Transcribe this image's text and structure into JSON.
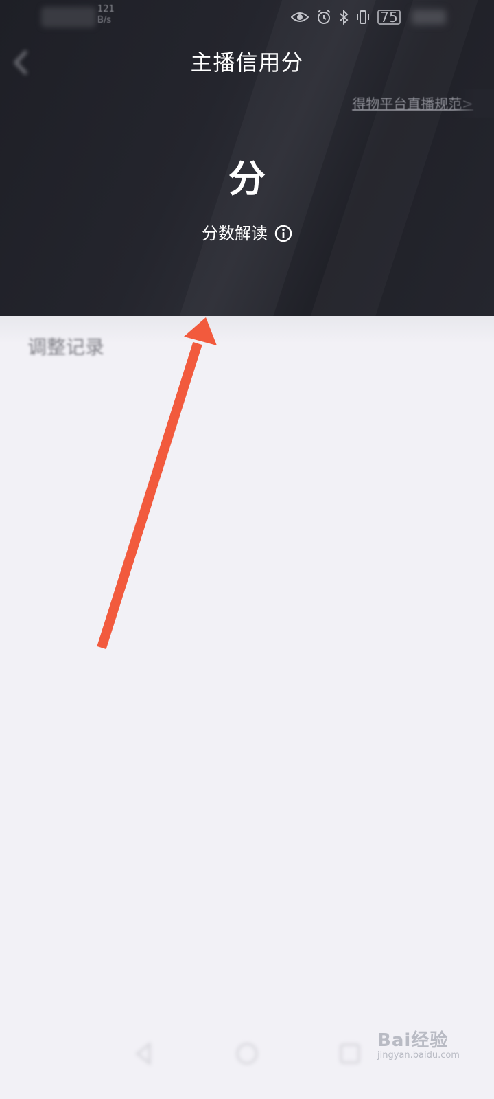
{
  "status_bar": {
    "net_speed_value": "121",
    "net_speed_unit": "B/s",
    "battery": "75"
  },
  "header": {
    "title": "主播信用分",
    "rules_link": "得物平台直播规范>",
    "score_value": "分",
    "score_explain": "分数解读"
  },
  "content": {
    "section_label": "调整记录"
  },
  "watermark": {
    "logo": "Bai经验",
    "url": "jingyan.baidu.com"
  },
  "colors": {
    "header_bg": "#202128",
    "page_bg": "#f2f1f6",
    "arrow": "#f25a3d"
  }
}
